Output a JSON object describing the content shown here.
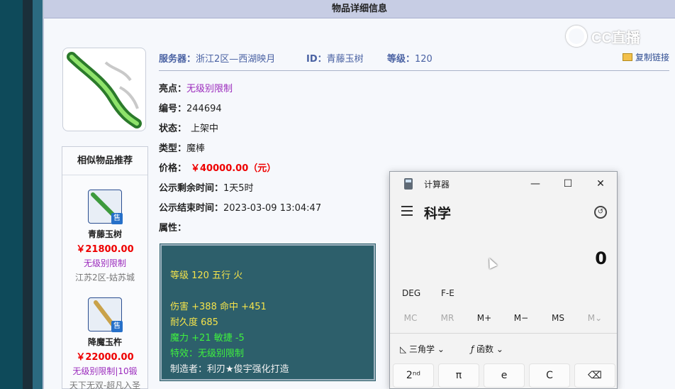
{
  "header": {
    "title": "物品详细信息"
  },
  "watermark": {
    "text": "CC直播"
  },
  "item": {
    "server_label": "服务器：",
    "server_value": "浙江2区—西湖映月",
    "id_label": "ID：",
    "id_value": "青藤玉树",
    "level_label": "等级：",
    "level_value": "120",
    "copy_link": "复制链接",
    "highlight_label": "亮点：",
    "highlight_value": "无级别限制",
    "number_label": "编号：",
    "number_value": "244694",
    "status_label": "状态：",
    "status_value": "上架中",
    "type_label": "类型：",
    "type_value": "魔棒",
    "price_label": "价格：",
    "price_value": "￥40000.00（元）",
    "remain_label": "公示剩余时间：",
    "remain_value": "1天5时",
    "end_label": "公示结束时间：",
    "end_value": "2023-03-09 13:04:47",
    "attr_label": "属性："
  },
  "attributes": {
    "line1": "等级 120 五行 火",
    "line2": "伤害 +388 命中 +451",
    "line3": "耐久度 685",
    "line4": "魔力 +21 敏捷 -5",
    "line5": "特效：无级别限制",
    "line6": "制造者：利刃★俊宇强化打造"
  },
  "similar": {
    "title": "相似物品推荐",
    "items": [
      {
        "name": "青藤玉树",
        "price": "￥21800.00",
        "tag": "无级别限制",
        "server": "江苏2区-姑苏城",
        "sell": "售"
      },
      {
        "name": "降魔玉杵",
        "price": "￥22000.00",
        "tag": "无级别限制|10锻",
        "server": "天下无双-超凡入圣",
        "sell": "售"
      }
    ]
  },
  "calculator": {
    "window_title": "计算器",
    "minimize": "—",
    "maximize": "☐",
    "close": "✕",
    "mode": "科学",
    "display": "0",
    "deg": "DEG",
    "fe": "F-E",
    "mem": [
      "MC",
      "MR",
      "M+",
      "M−",
      "MS",
      "M⌄"
    ],
    "trig": "三角学",
    "func": "函数",
    "keys": [
      "2ⁿᵈ",
      "π",
      "e",
      "C",
      "⌫"
    ]
  }
}
